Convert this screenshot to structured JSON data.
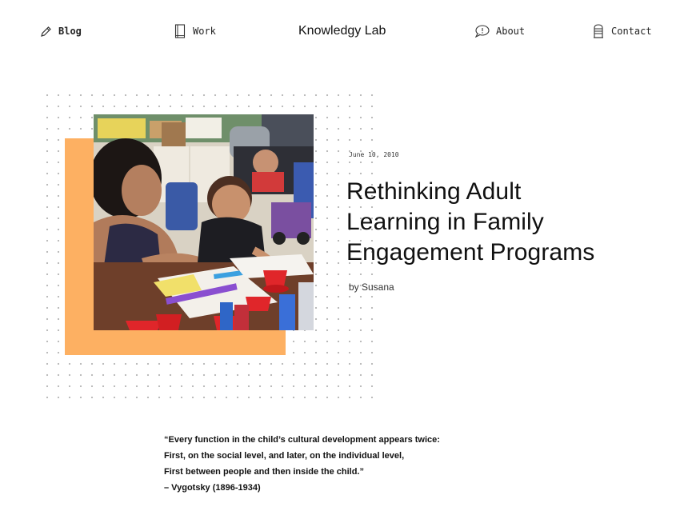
{
  "nav": {
    "blog": {
      "label": "Blog",
      "icon": "pencil-icon"
    },
    "work": {
      "label": "Work",
      "icon": "book-icon"
    },
    "brand": "Knowledgy Lab",
    "about": {
      "label": "About",
      "icon": "speech-bubble-icon"
    },
    "contact": {
      "label": "Contact",
      "icon": "mailbox-icon"
    }
  },
  "post": {
    "date": "June 10, 2010",
    "title_lines": [
      "Rethinking Adult",
      "Learning in Family",
      "Engagement Programs"
    ],
    "author": "by Susana"
  },
  "quote": {
    "lines": [
      "“Every function in the child’s cultural development appears twice:",
      "First, on the social level, and later, on the individual level,",
      "First between people and then inside the child.”",
      "– Vygotsky (1896-1934)"
    ]
  },
  "colors": {
    "accent_orange": "#fdb062",
    "text": "#111111",
    "dot_grid": "#b8b8b8"
  }
}
